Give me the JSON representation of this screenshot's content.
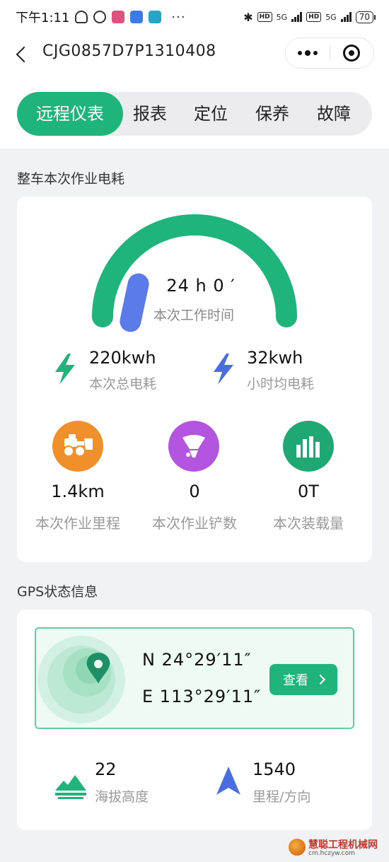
{
  "status_bar": {
    "time": "下午1:11",
    "more": "···",
    "network": "5G",
    "hd": "HD",
    "battery": "70"
  },
  "nav": {
    "title": "CJG0857D7P1310408"
  },
  "tabs": [
    {
      "label": "远程仪表",
      "active": true
    },
    {
      "label": "报表",
      "active": false
    },
    {
      "label": "定位",
      "active": false
    },
    {
      "label": "保养",
      "active": false
    },
    {
      "label": "故障",
      "active": false
    }
  ],
  "energy": {
    "section_title": "整车本次作业电耗",
    "work_time": "24 h 0 ′",
    "work_time_label": "本次工作时间",
    "total_value": "220kwh",
    "total_label": "本次总电耗",
    "hourly_value": "32kwh",
    "hourly_label": "小时均电耗",
    "metrics": [
      {
        "value": "1.4km",
        "label": "本次作业里程",
        "icon": "loader-icon",
        "color": "#f0902a"
      },
      {
        "value": "0",
        "label": "本次作业铲数",
        "icon": "bucket-icon",
        "color": "#b455e0"
      },
      {
        "value": "0T",
        "label": "本次装载量",
        "icon": "bar-chart-icon",
        "color": "#1fa774"
      }
    ],
    "colors": {
      "gauge_track": "#1fb47b",
      "gauge_needle": "#5b7be8",
      "bolt_green": "#1fb47b",
      "bolt_blue": "#4a6ee0"
    }
  },
  "gps": {
    "section_title": "GPS状态信息",
    "lat": "N 24°29′11″",
    "lng": "E 113°29′11″",
    "view_label": "查看",
    "altitude_value": "22",
    "altitude_label": "海拔高度",
    "heading_value": "1540",
    "heading_label": "里程/方向"
  },
  "watermark": {
    "name": "慧聪工程机械网",
    "url": "cm.hczyw.com"
  }
}
